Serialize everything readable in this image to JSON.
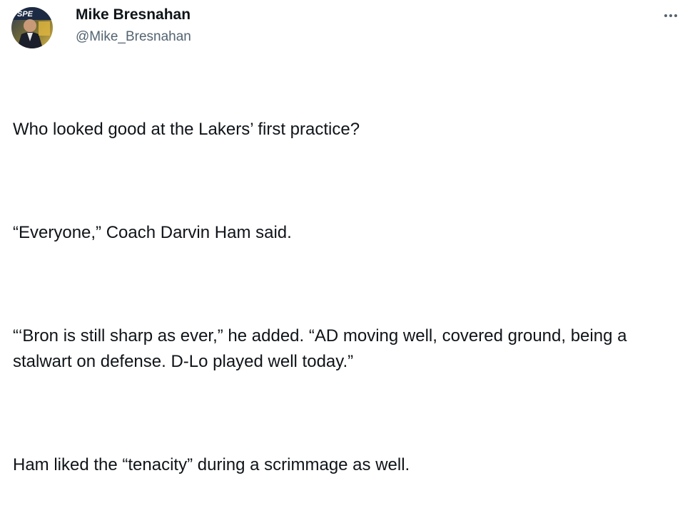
{
  "author": {
    "display_name": "Mike Bresnahan",
    "handle": "@Mike_Bresnahan",
    "avatar_text": "SPE"
  },
  "menu": {
    "icon": "more-horizontal-icon"
  },
  "tweet": {
    "paragraphs": [
      "Who looked good at the Lakers’ first practice?",
      "“Everyone,” Coach Darvin Ham said.",
      "“‘Bron is still sharp as ever,” he added. “AD moving well, covered ground, being a stalwart on defense. D-Lo played well today.”",
      "Ham liked the “tenacity” during a scrimmage as well."
    ]
  }
}
